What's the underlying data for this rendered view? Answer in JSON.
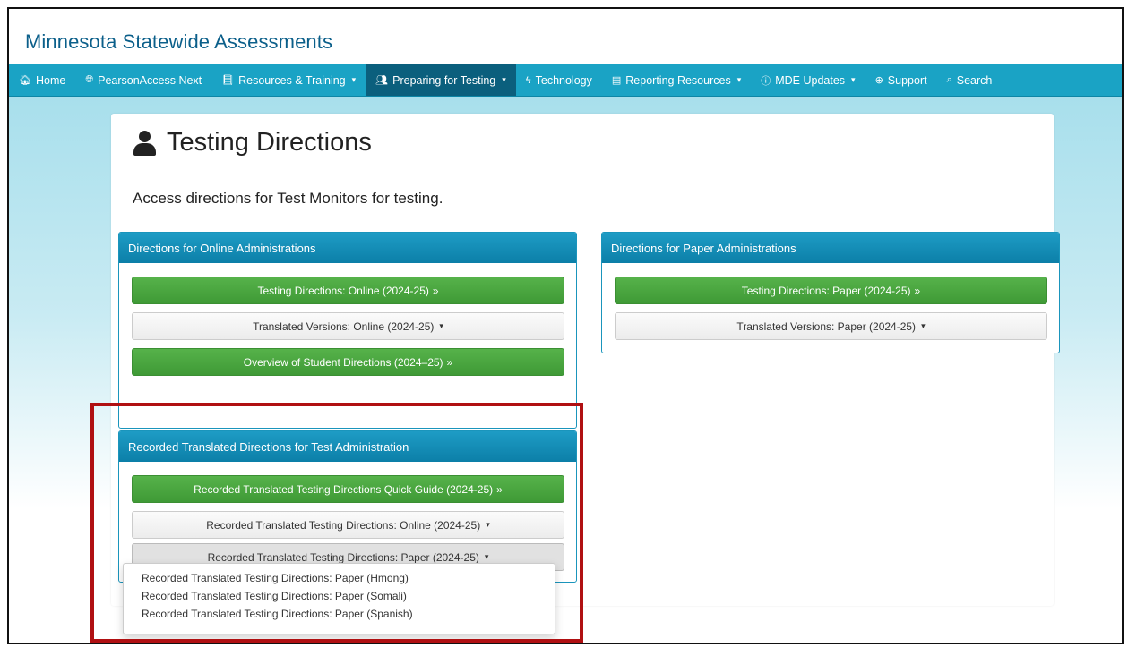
{
  "site": {
    "title": "Minnesota Statewide Assessments"
  },
  "nav": {
    "items": [
      {
        "label": "Home",
        "icon": "home-icon",
        "glyph": "🏠︎",
        "dropdown": false,
        "active": false
      },
      {
        "label": "PearsonAccess Next",
        "icon": "globe-icon",
        "glyph": "🌐︎",
        "dropdown": false,
        "active": false
      },
      {
        "label": "Resources & Training",
        "icon": "book-icon",
        "glyph": "📘︎",
        "dropdown": true,
        "active": false
      },
      {
        "label": "Preparing for Testing",
        "icon": "group-icon",
        "glyph": "👥︎",
        "dropdown": true,
        "active": true
      },
      {
        "label": "Technology",
        "icon": "bolt-icon",
        "glyph": "ϟ",
        "dropdown": false,
        "active": false
      },
      {
        "label": "Reporting Resources",
        "icon": "newspaper-icon",
        "glyph": "▤",
        "dropdown": true,
        "active": false
      },
      {
        "label": "MDE Updates",
        "icon": "info-icon",
        "glyph": "ⓘ",
        "dropdown": true,
        "active": false
      },
      {
        "label": "Support",
        "icon": "lifebuoy-icon",
        "glyph": "⊕",
        "dropdown": false,
        "active": false
      },
      {
        "label": "Search",
        "icon": "search-icon",
        "glyph": "⌕",
        "dropdown": false,
        "active": false
      }
    ]
  },
  "page": {
    "title": "Testing Directions",
    "intro": "Access directions for Test Monitors for testing."
  },
  "panels": {
    "online": {
      "heading": "Directions for Online Administrations",
      "btn1": "Testing Directions: Online (2024-25)",
      "btn2": "Translated Versions: Online (2024-25)",
      "btn3": "Overview of Student Directions (2024–25)"
    },
    "paper": {
      "heading": "Directions for Paper Administrations",
      "btn1": "Testing Directions: Paper (2024-25)",
      "btn2": "Translated Versions: Paper (2024-25)"
    },
    "recorded": {
      "heading": "Recorded Translated Directions for Test Administration",
      "btn1": "Recorded Translated Testing Directions Quick Guide (2024-25)",
      "btn2": "Recorded Translated Testing Directions: Online (2024-25)",
      "btn3": "Recorded Translated Testing Directions: Paper (2024-25)"
    }
  },
  "dropdown": {
    "items": [
      "Recorded Translated Testing Directions: Paper (Hmong)",
      "Recorded Translated Testing Directions: Paper (Somali)",
      "Recorded Translated Testing Directions: Paper (Spanish)"
    ]
  },
  "glyphs": {
    "double_chevron": "»",
    "caret": "▾"
  },
  "colors": {
    "nav_bg": "#1aa3c5",
    "nav_active": "#0b5f7d",
    "panel_heading": "#0c7fa8",
    "green_button": "#3f9a36",
    "highlight": "#b01012",
    "title": "#0b5f8a"
  }
}
